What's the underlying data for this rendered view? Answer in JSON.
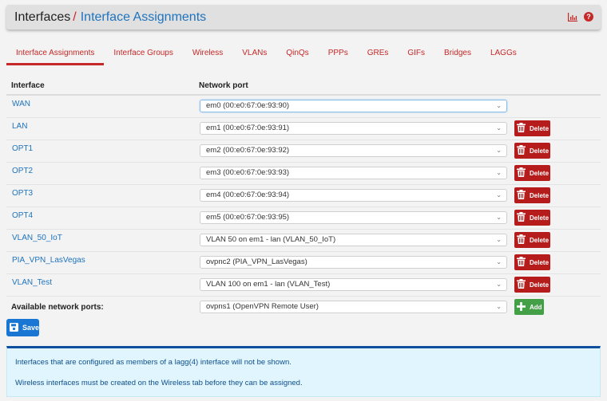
{
  "header": {
    "breadcrumb_root": "Interfaces",
    "breadcrumb_sep": "/",
    "breadcrumb_current": "Interface Assignments",
    "icons": [
      "chart-icon",
      "help-icon"
    ]
  },
  "tabs": [
    {
      "label": "Interface Assignments",
      "active": true
    },
    {
      "label": "Interface Groups"
    },
    {
      "label": "Wireless"
    },
    {
      "label": "VLANs"
    },
    {
      "label": "QinQs"
    },
    {
      "label": "PPPs"
    },
    {
      "label": "GREs"
    },
    {
      "label": "GIFs"
    },
    {
      "label": "Bridges"
    },
    {
      "label": "LAGGs"
    }
  ],
  "table": {
    "col_interface": "Interface",
    "col_port": "Network port",
    "rows": [
      {
        "interface": "WAN",
        "port": "em0 (00:e0:67:0e:93:90)"
      },
      {
        "interface": "LAN",
        "port": "em1 (00:e0:67:0e:93:91)",
        "action": "Delete"
      },
      {
        "interface": "OPT1",
        "port": "em2 (00:e0:67:0e:93:92)",
        "action": "Delete"
      },
      {
        "interface": "OPT2",
        "port": "em3 (00:e0:67:0e:93:93)",
        "action": "Delete"
      },
      {
        "interface": "OPT3",
        "port": "em4 (00:e0:67:0e:93:94)",
        "action": "Delete"
      },
      {
        "interface": "OPT4",
        "port": "em5 (00:e0:67:0e:93:95)",
        "action": "Delete"
      },
      {
        "interface": "VLAN_50_IoT",
        "port": "VLAN 50 on em1 - lan (VLAN_50_IoT)",
        "action": "Delete"
      },
      {
        "interface": "PIA_VPN_LasVegas",
        "port": "ovpnc2 (PIA_VPN_LasVegas)",
        "action": "Delete"
      },
      {
        "interface": "VLAN_Test",
        "port": "VLAN 100 on em1 - lan (VLAN_Test)",
        "action": "Delete"
      }
    ],
    "available_label": "Available network ports:",
    "available_port": "ovpns1 (OpenVPN Remote User)",
    "add_label": "Add"
  },
  "save_label": "Save",
  "info": {
    "line1": "Interfaces that are configured as members of a lagg(4) interface will not be shown.",
    "line2": "Wireless interfaces must be created on the Wireless tab before they can be assigned."
  },
  "colors": {
    "accent_red": "#c62828",
    "delete_red": "#b71c1c",
    "link_blue": "#1e73be",
    "save_blue": "#1976d2",
    "add_green": "#43a047",
    "info_bg": "#e1f5fe"
  }
}
